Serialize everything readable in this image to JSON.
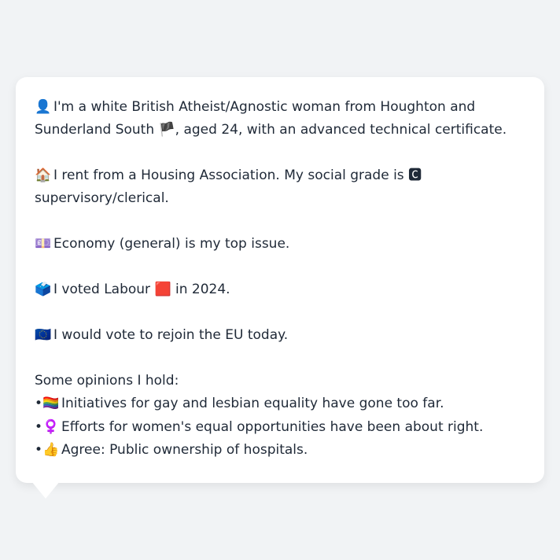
{
  "persona": {
    "intro": {
      "icon": "👤",
      "text": "I'm a white British Atheist/Agnostic woman from Houghton and Sunderland South 🏴, aged 24, with an advanced technical certificate."
    },
    "housing": {
      "icon": "🏠",
      "text": "I rent from a Housing Association. My social grade is 🅲 supervisory/clerical."
    },
    "issue": {
      "icon": "💷",
      "text": "Economy (general) is my top issue."
    },
    "vote": {
      "icon": "🗳️",
      "text": "I voted Labour 🟥 in 2024."
    },
    "eu": {
      "icon": "🇪🇺",
      "text": "I would vote to rejoin the EU today."
    },
    "opinions_heading": "Some opinions I hold:",
    "opinions": [
      {
        "bullet": "•",
        "icon": "🏳️‍🌈",
        "text": "Initiatives for gay and lesbian equality have gone too far."
      },
      {
        "bullet": "•",
        "icon": "♀️",
        "text": "Efforts for women's equal opportunities have been about right."
      },
      {
        "bullet": "•",
        "icon": "👍",
        "text": "Agree: Public ownership of hospitals."
      }
    ]
  }
}
